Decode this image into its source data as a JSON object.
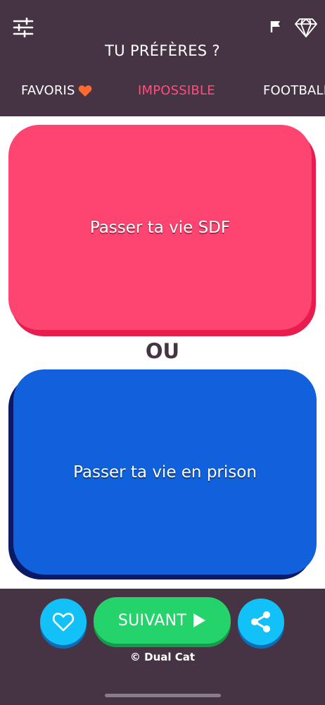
{
  "header": {
    "title": "TU PRÉFÈRES ?",
    "icons": [
      "sliders-icon",
      "flag-icon",
      "diamond-icon"
    ]
  },
  "tabs": [
    {
      "label": "FAVORIS",
      "icon": "heart-icon",
      "icon_color": "#ff6b2c"
    },
    {
      "label": "IMPOSSIBLE",
      "active": true,
      "color": "#ff4e7c"
    },
    {
      "label": "FOOTBALL"
    }
  ],
  "choices": {
    "option_a": "Passer ta vie SDF",
    "separator": "OU",
    "option_b": "Passer ta vie en prison"
  },
  "footer": {
    "like_icon": "heart-outline-icon",
    "next_label": "SUIVANT",
    "next_icon": "play-icon",
    "share_icon": "share-icon",
    "copyright": "© Dual Cat"
  },
  "colors": {
    "header_bg": "#463444",
    "option_a": "#fe4471",
    "option_b": "#1061db",
    "next_button": "#24d46b",
    "round_buttons": "#12c1f7"
  }
}
